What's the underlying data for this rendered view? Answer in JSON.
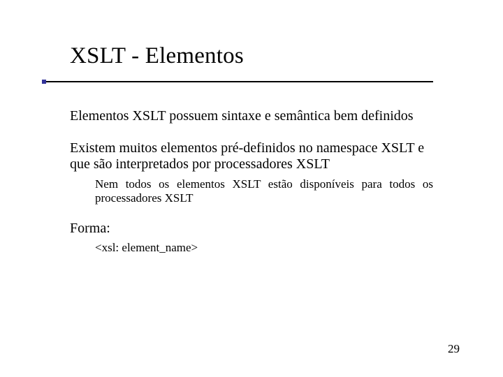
{
  "title": "XSLT - Elementos",
  "paragraphs": {
    "p1": "Elementos XSLT possuem sintaxe e semântica bem definidos",
    "p2": "Existem muitos elementos pré-definidos no namespace XSLT e que são interpretados por processadores XSLT",
    "p2_sub": "Nem todos os elementos XSLT estão disponíveis para todos os processadores XSLT",
    "p3": "Forma:",
    "p3_sub": "<xsl: element_name>"
  },
  "page_number": "29"
}
